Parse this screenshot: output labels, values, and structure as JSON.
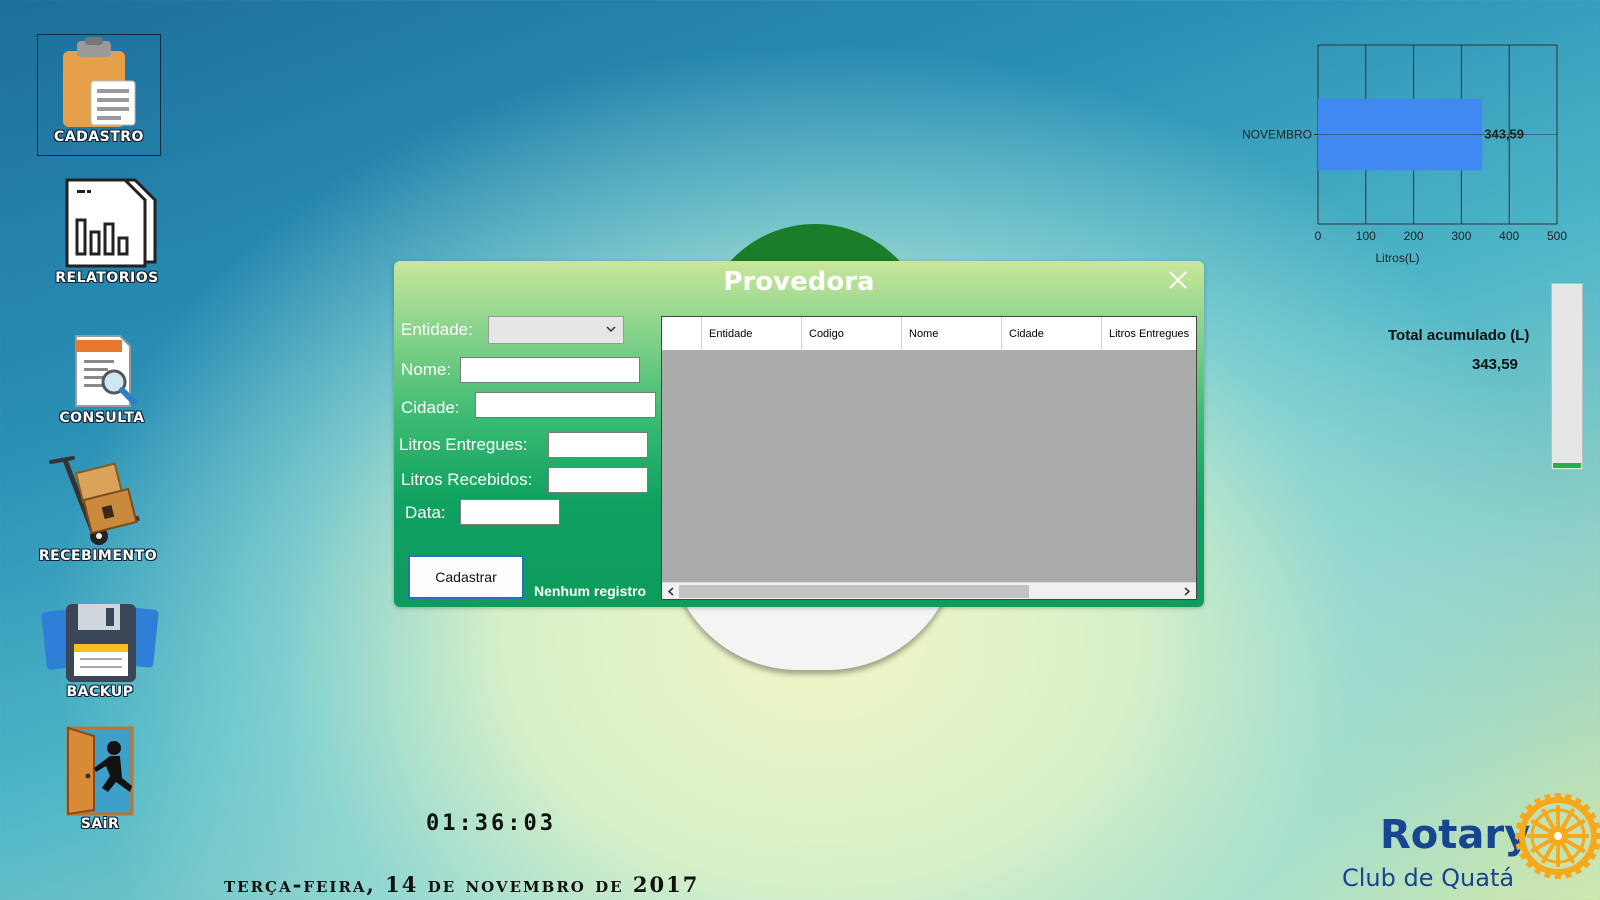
{
  "sidebar": {
    "items": [
      {
        "label": "CADASTRO",
        "icon": "clipboard-icon"
      },
      {
        "label": "RELATORIOS",
        "icon": "report-chart-icon"
      },
      {
        "label": "CONSULTA",
        "icon": "document-search-icon"
      },
      {
        "label": "RECEBIMENTO",
        "icon": "hand-truck-boxes-icon"
      },
      {
        "label": "BACKUP",
        "icon": "floppy-disk-icon"
      },
      {
        "label": "SAiR",
        "icon": "exit-door-icon"
      }
    ]
  },
  "dialog": {
    "title": "Provedora",
    "form": {
      "entidade_label": "Entidade:",
      "entidade_value": "",
      "nome_label": "Nome:",
      "nome_value": "",
      "cidade_label": "Cidade:",
      "cidade_value": "",
      "litros_entregues_label": "Litros Entregues:",
      "litros_entregues_value": "",
      "litros_recebidos_label": "Litros Recebidos:",
      "litros_recebidos_value": "",
      "data_label": "Data:",
      "data_value": ""
    },
    "submit_label": "Cadastrar",
    "status_text": "Nenhum registro",
    "grid": {
      "columns": [
        "",
        "Entidade",
        "Codigo",
        "Nome",
        "Cidade",
        "Litros Entregues"
      ],
      "rows": []
    }
  },
  "chart_data": {
    "type": "bar",
    "orientation": "horizontal",
    "categories": [
      "NOVEMBRO"
    ],
    "values": [
      343.59
    ],
    "data_labels": [
      "343,59"
    ],
    "xlabel": "Litros(L)",
    "xlim": [
      0,
      500
    ],
    "xticks": [
      0,
      100,
      200,
      300,
      400,
      500
    ],
    "grid": true,
    "bar_color": "#4189f0"
  },
  "summary": {
    "total_label": "Total acumulado (L)",
    "total_value": "343,59",
    "progress_fraction": 0.02,
    "progress_color": "#22b14c"
  },
  "clock": "01:36:03",
  "date": "terça-feira, 14 de novembro de 2017",
  "brand": {
    "rotary": "Rotary",
    "club": "Club de Quatá",
    "color": "#17458f",
    "wheel_color": "#f7a81b"
  }
}
